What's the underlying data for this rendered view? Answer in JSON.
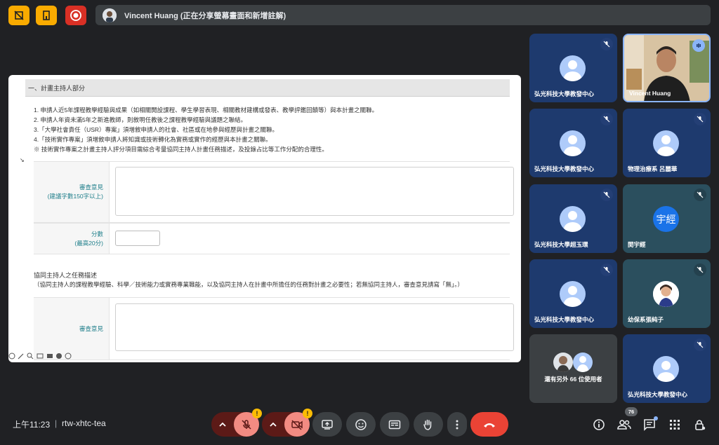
{
  "top": {
    "presenter_label": "Vincent Huang (正在分享螢幕畫面和新增註解)"
  },
  "document": {
    "section_header": "一、計畫主持人部分",
    "items": [
      "1. 申請人近5年課程教學經驗與成果（如相關開設課程、學生學習表現、相關教材建構或發表、教學評鑑回饋等）與本計畫之關聯。",
      "2. 申請人年資未滿5年之新進教師，則敘明任教後之課程教學經驗與議題之聯結。",
      "3.「大學社會責任（USR）專案」須增敘申請人的社會、社區或在地參與經歷與計畫之關聯。",
      "4.「技術實作專案」須增敘申請人將知識或技術轉化為實務或實作的經歷與本計畫之關聯。",
      "※ 技術實作專案之計畫主持人評分項目需綜合考量協同主持人計畫任務描述，及投錄占比等工作分配的合理性。"
    ],
    "review_label": "審查意見",
    "review_hint": "(建議字數150字以上)",
    "score_label": "分數",
    "score_hint": "(最高20分)",
    "co_title": "協同主持人之任務描述",
    "co_desc": "（協同主持人的課程教學經驗、科學／技術能力或實務專業職能，以及協同主持人在計畫中所擔任的任務對計畫之必要性；若無協同主持人，審查意見請寫「無」。）",
    "review_label_2": "審查意見"
  },
  "participants": [
    {
      "name": "弘光科技大學教發中心",
      "kind": "avatar",
      "muted": true
    },
    {
      "name": "Vincent Huang",
      "kind": "video",
      "speaking": true
    },
    {
      "name": "弘光科技大學教發中心",
      "kind": "avatar",
      "muted": true
    },
    {
      "name": "物理治療系 呂麗華",
      "kind": "avatar",
      "muted": true
    },
    {
      "name": "弘光科技大學超玉環",
      "kind": "avatar",
      "muted": true
    },
    {
      "name": "閔宇經",
      "kind": "letter",
      "letter": "宇經",
      "muted": true
    },
    {
      "name": "弘光科技大學教發中心",
      "kind": "avatar",
      "muted": true
    },
    {
      "name": "幼保系張純子",
      "kind": "photo",
      "muted": true
    },
    {
      "name": "還有另外 66 位使用者",
      "kind": "more"
    },
    {
      "name": "弘光科技大學教發中心",
      "kind": "avatar",
      "muted": true
    }
  ],
  "bottom": {
    "time": "上午11:23",
    "separator": "|",
    "meeting_code": "rtw-xhtc-tea",
    "people_count": "76",
    "warn_symbol": "!"
  },
  "colors": {
    "tile_blue": "#1e3a6e",
    "end_call": "#ea4335",
    "accent_yellow": "#f9ab00",
    "rec_red": "#d93025"
  }
}
